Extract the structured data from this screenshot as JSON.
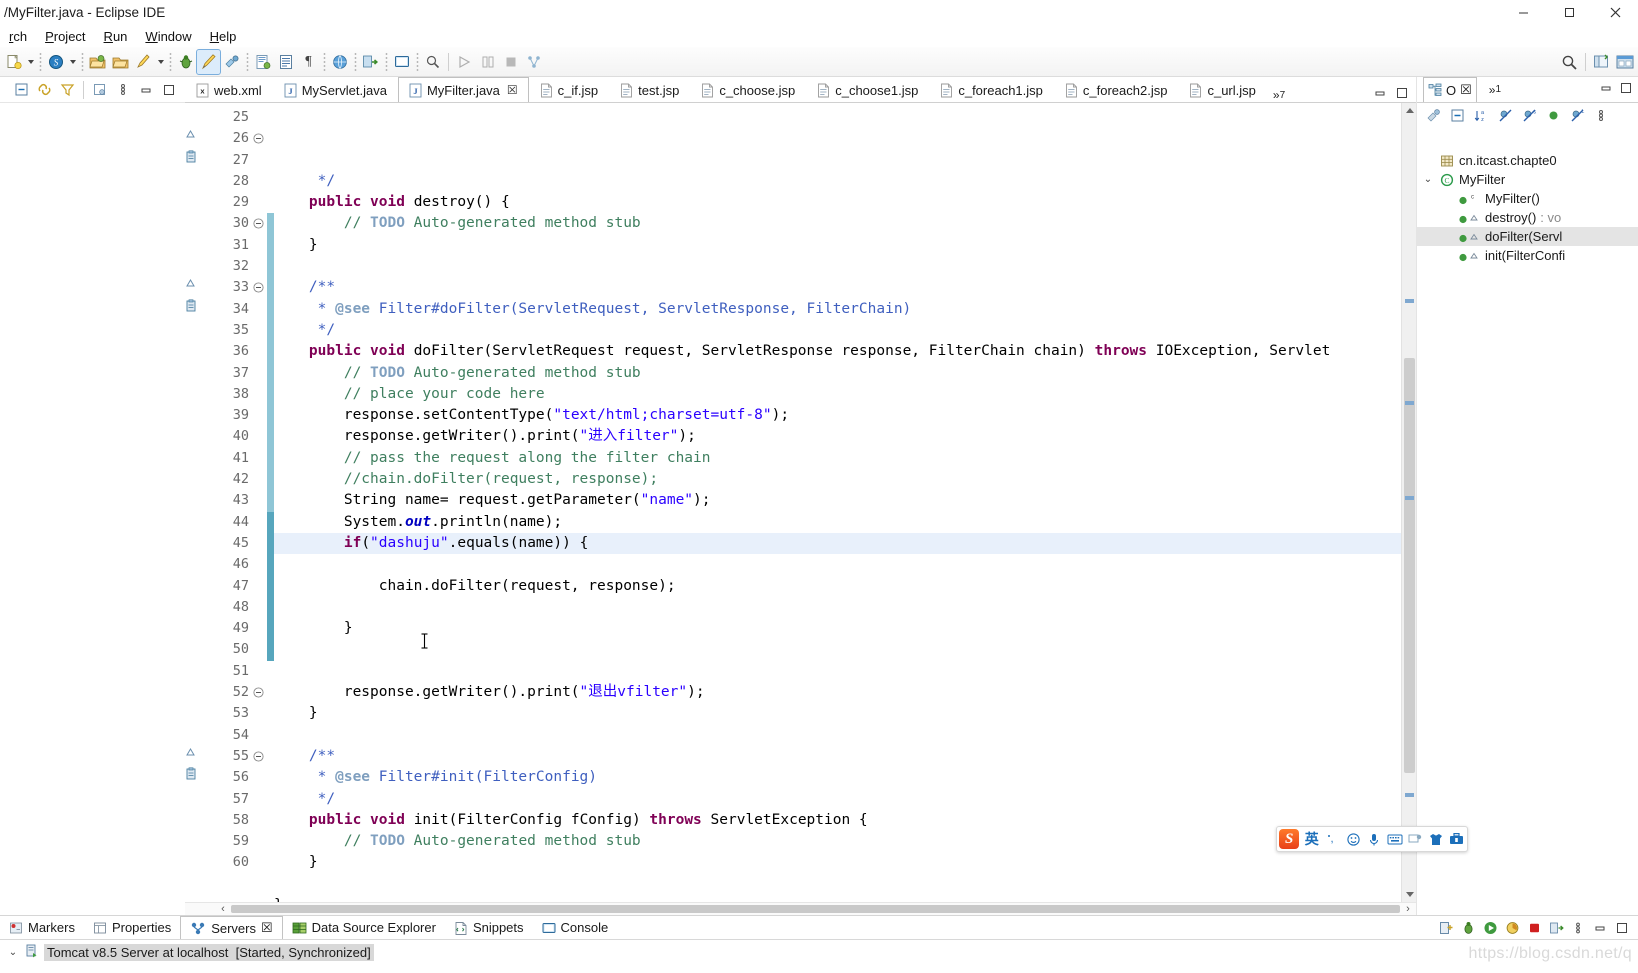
{
  "window": {
    "title": "/MyFilter.java - Eclipse IDE",
    "minimize": "─",
    "maximize": "☐",
    "close": "✕"
  },
  "menubar": {
    "items": [
      {
        "label": "rch"
      },
      {
        "label": "Project"
      },
      {
        "label": "Run"
      },
      {
        "label": "Window"
      },
      {
        "label": "Help"
      }
    ]
  },
  "tabs": {
    "items": [
      {
        "label": "web.xml",
        "kind": "X",
        "selected": false,
        "closable": false
      },
      {
        "label": "MyServlet.java",
        "kind": "J",
        "selected": false,
        "closable": false
      },
      {
        "label": "MyFilter.java",
        "kind": "J",
        "selected": true,
        "closable": true
      },
      {
        "label": "c_if.jsp",
        "kind": "D",
        "selected": false,
        "closable": false
      },
      {
        "label": "test.jsp",
        "kind": "D",
        "selected": false,
        "closable": false
      },
      {
        "label": "c_choose.jsp",
        "kind": "D",
        "selected": false,
        "closable": false
      },
      {
        "label": "c_choose1.jsp",
        "kind": "D",
        "selected": false,
        "closable": false
      },
      {
        "label": "c_foreach1.jsp",
        "kind": "D",
        "selected": false,
        "closable": false
      },
      {
        "label": "c_foreach2.jsp",
        "kind": "D",
        "selected": false,
        "closable": false
      },
      {
        "label": "c_url.jsp",
        "kind": "D",
        "selected": false,
        "closable": false
      }
    ],
    "overflow": "»",
    "overflow_count": "7",
    "close_symbol": "☒"
  },
  "editor": {
    "first_line": 25,
    "current_line": 45,
    "lines": [
      {
        "n": 25,
        "fold": "",
        "ann": "",
        "indent": 1,
        "text": " */"
      },
      {
        "n": 26,
        "fold": "⊖",
        "ann": "over",
        "indent": 1,
        "text": "public void destroy() {"
      },
      {
        "n": 27,
        "fold": "",
        "ann": "todo",
        "indent": 2,
        "text": "// TODO Auto-generated method stub"
      },
      {
        "n": 28,
        "fold": "",
        "ann": "",
        "indent": 1,
        "text": "}"
      },
      {
        "n": 29,
        "fold": "",
        "ann": "",
        "indent": 0,
        "text": ""
      },
      {
        "n": 30,
        "fold": "⊖",
        "ann": "",
        "indent": 1,
        "text": "/**"
      },
      {
        "n": 31,
        "fold": "",
        "ann": "",
        "indent": 1,
        "text": " * @see Filter#doFilter(ServletRequest, ServletResponse, FilterChain)"
      },
      {
        "n": 32,
        "fold": "",
        "ann": "",
        "indent": 1,
        "text": " */"
      },
      {
        "n": 33,
        "fold": "⊖",
        "ann": "over",
        "indent": 1,
        "text": "public void doFilter(ServletRequest request, ServletResponse response, FilterChain chain) throws IOException, Servlet"
      },
      {
        "n": 34,
        "fold": "",
        "ann": "todo",
        "indent": 2,
        "text": "// TODO Auto-generated method stub"
      },
      {
        "n": 35,
        "fold": "",
        "ann": "",
        "indent": 2,
        "text": "// place your code here"
      },
      {
        "n": 36,
        "fold": "",
        "ann": "",
        "indent": 2,
        "text": "response.setContentType(\"text/html;charset=utf-8\");"
      },
      {
        "n": 37,
        "fold": "",
        "ann": "",
        "indent": 2,
        "text": "response.getWriter().print(\"进入filter\");"
      },
      {
        "n": 38,
        "fold": "",
        "ann": "",
        "indent": 2,
        "text": "// pass the request along the filter chain"
      },
      {
        "n": 39,
        "fold": "",
        "ann": "",
        "indent": 2,
        "text": "//chain.doFilter(request, response);"
      },
      {
        "n": 40,
        "fold": "",
        "ann": "",
        "indent": 2,
        "text": "String name= request.getParameter(\"name\");"
      },
      {
        "n": 41,
        "fold": "",
        "ann": "",
        "indent": 2,
        "text": "System.out.println(name);"
      },
      {
        "n": 42,
        "fold": "",
        "ann": "",
        "indent": 2,
        "text": "if(\"dashuju\".equals(name)) {"
      },
      {
        "n": 43,
        "fold": "",
        "ann": "",
        "indent": 0,
        "text": ""
      },
      {
        "n": 44,
        "fold": "",
        "ann": "",
        "indent": 3,
        "text": "chain.doFilter(request, response);"
      },
      {
        "n": 45,
        "fold": "",
        "ann": "",
        "indent": 0,
        "text": ""
      },
      {
        "n": 46,
        "fold": "",
        "ann": "",
        "indent": 2,
        "text": "}"
      },
      {
        "n": 47,
        "fold": "",
        "ann": "",
        "indent": 0,
        "text": ""
      },
      {
        "n": 48,
        "fold": "",
        "ann": "",
        "indent": 0,
        "text": ""
      },
      {
        "n": 49,
        "fold": "",
        "ann": "",
        "indent": 2,
        "text": "response.getWriter().print(\"退出vfilter\");"
      },
      {
        "n": 50,
        "fold": "",
        "ann": "",
        "indent": 1,
        "text": "}"
      },
      {
        "n": 51,
        "fold": "",
        "ann": "",
        "indent": 0,
        "text": ""
      },
      {
        "n": 52,
        "fold": "⊖",
        "ann": "",
        "indent": 1,
        "text": "/**"
      },
      {
        "n": 53,
        "fold": "",
        "ann": "",
        "indent": 1,
        "text": " * @see Filter#init(FilterConfig)"
      },
      {
        "n": 54,
        "fold": "",
        "ann": "",
        "indent": 1,
        "text": " */"
      },
      {
        "n": 55,
        "fold": "⊖",
        "ann": "over",
        "indent": 1,
        "text": "public void init(FilterConfig fConfig) throws ServletException {"
      },
      {
        "n": 56,
        "fold": "",
        "ann": "todo",
        "indent": 2,
        "text": "// TODO Auto-generated method stub"
      },
      {
        "n": 57,
        "fold": "",
        "ann": "",
        "indent": 1,
        "text": "}"
      },
      {
        "n": 58,
        "fold": "",
        "ann": "",
        "indent": 0,
        "text": ""
      },
      {
        "n": 59,
        "fold": "",
        "ann": "",
        "indent": 0,
        "text": "}"
      },
      {
        "n": 60,
        "fold": "",
        "ann": "",
        "indent": 0,
        "text": ""
      }
    ]
  },
  "outline": {
    "tab_label": "O",
    "tab_close": "☒",
    "overflow": "»",
    "overflow_count": "1",
    "minimize": "─",
    "maximize": "☐",
    "items": [
      {
        "label": "cn.itcast.chapte0",
        "icon": "package-icon",
        "indent": 1,
        "twisty": "",
        "selected": false,
        "ret": ""
      },
      {
        "label": "MyFilter",
        "icon": "class-icon",
        "indent": 1,
        "twisty": "⌄",
        "selected": false,
        "ret": ""
      },
      {
        "label": "MyFilter()",
        "icon": "constructor-icon",
        "indent": 2,
        "twisty": "",
        "selected": false,
        "ret": ""
      },
      {
        "label": "destroy()",
        "icon": "method-icon",
        "indent": 2,
        "twisty": "",
        "selected": false,
        "ret": " : vo"
      },
      {
        "label": "doFilter(Servl",
        "icon": "method-icon",
        "indent": 2,
        "twisty": "",
        "selected": true,
        "ret": ""
      },
      {
        "label": "init(FilterConfi",
        "icon": "method-icon",
        "indent": 2,
        "twisty": "",
        "selected": false,
        "ret": ""
      }
    ]
  },
  "bottom": {
    "tabs": [
      {
        "label": "Markers",
        "icon": "marker-icon",
        "selected": false,
        "closable": false
      },
      {
        "label": "Properties",
        "icon": "properties-icon",
        "selected": false,
        "closable": false
      },
      {
        "label": "Servers",
        "icon": "servers-icon",
        "selected": true,
        "closable": true
      },
      {
        "label": "Data Source Explorer",
        "icon": "datasource-icon",
        "selected": false,
        "closable": false
      },
      {
        "label": "Snippets",
        "icon": "snippets-icon",
        "selected": false,
        "closable": false
      },
      {
        "label": "Console",
        "icon": "console-icon",
        "selected": false,
        "closable": false
      }
    ],
    "close_symbol": "☒",
    "server": {
      "twisty": "⌄",
      "name": "Tomcat v8.5 Server at localhost",
      "status": "[Started, Synchronized]"
    }
  },
  "ime": {
    "logo": "S",
    "mode": "英",
    "items": [
      "punctuation-icon",
      "emoji-icon",
      "mic-icon",
      "keyboard-icon",
      "screenshot-icon",
      "skin-icon",
      "toolbox-icon"
    ]
  },
  "watermark": "https://blog.csdn.net/q"
}
